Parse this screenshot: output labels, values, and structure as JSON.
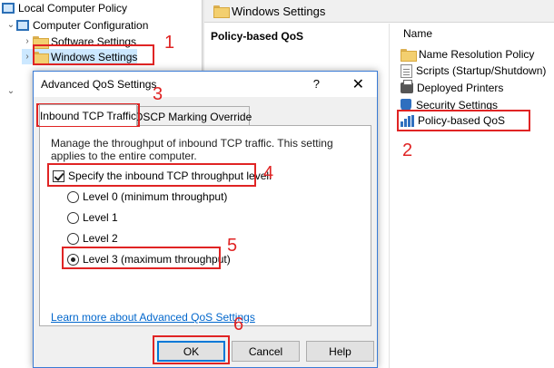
{
  "tree": {
    "root": "Local Computer Policy",
    "computer_config": "Computer Configuration",
    "software_settings": "Software Settings",
    "windows_settings": "Windows Settings"
  },
  "header": {
    "title": "Windows Settings"
  },
  "middle": {
    "title": "Policy-based QoS"
  },
  "list": {
    "column": "Name",
    "items": [
      "Name Resolution Policy",
      "Scripts (Startup/Shutdown)",
      "Deployed Printers",
      "Security Settings",
      "Policy-based QoS"
    ]
  },
  "dialog": {
    "title": "Advanced QoS Settings",
    "help": "?",
    "close": "✕",
    "tabs": [
      "Inbound TCP Traffic",
      "DSCP Marking Override"
    ],
    "description": "Manage the throughput of inbound TCP traffic. This setting applies to the entire computer.",
    "checkbox_label": "Specify the inbound TCP throughput level:",
    "checkbox_checked": true,
    "levels": [
      "Level 0 (minimum throughput)",
      "Level 1",
      "Level 2",
      "Level 3 (maximum throughput)"
    ],
    "selected_level": 3,
    "link": "Learn more about Advanced QoS Settings",
    "buttons": {
      "ok": "OK",
      "cancel": "Cancel",
      "help": "Help"
    }
  },
  "annotations": [
    "1",
    "2",
    "3",
    "4",
    "5",
    "6"
  ],
  "colors": {
    "annotation": "#e02424",
    "link": "#0066cc",
    "accent": "#0078d7"
  }
}
